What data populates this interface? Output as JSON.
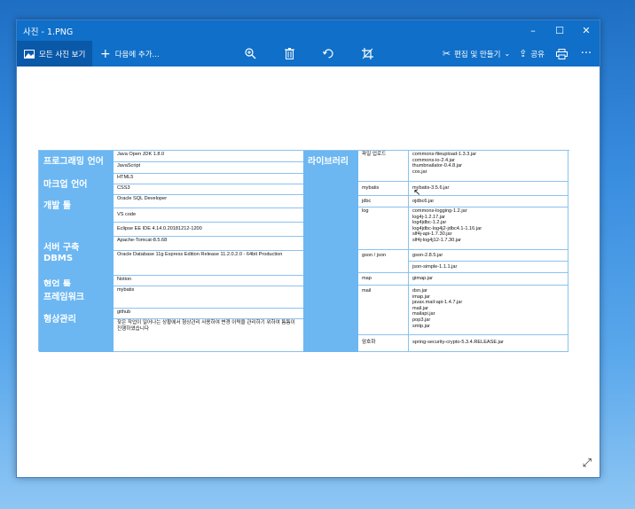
{
  "window": {
    "title": "사진 - 1.PNG",
    "controls": {
      "minimize": "–",
      "maximize": "☐",
      "close": "✕"
    }
  },
  "toolbar": {
    "all_photos": "모든 사진 보기",
    "add_to": "다음에 추가...",
    "edit_create": "편집 및 만들기",
    "share": "공유",
    "more": "···"
  },
  "icons": [
    "photo-icon",
    "plus-icon",
    "zoom-in-icon",
    "trash-icon",
    "rotate-icon",
    "crop-icon",
    "edit-icon",
    "share-icon",
    "print-icon",
    "more-icon",
    "expand-icon"
  ],
  "document": {
    "left": [
      {
        "category": "프로그래밍 언어",
        "values": [
          "Java Open JDK 1.8.0",
          "JavaScript"
        ]
      },
      {
        "category": "마크업 언어",
        "values": [
          "HTML5",
          "CSS3"
        ]
      },
      {
        "category": "개발 툴",
        "values": [
          "Oracle SQL Developer",
          "VS code",
          "Eclipse EE IDE 4.14.0.20181212-1200"
        ]
      },
      {
        "category": "서버 구축",
        "values": [
          "Apache-Tomcat-8.5.68"
        ]
      },
      {
        "category": "DBMS",
        "values": [
          "Oracle Database 11g Express Edition Release 11.2.0.2.0 - 64bit Production"
        ]
      },
      {
        "category": "협업 툴",
        "values": [
          "Notion"
        ]
      },
      {
        "category": "프레임워크",
        "values": [
          "mybatis"
        ]
      },
      {
        "category": "형상관리",
        "values": [
          "github",
          "잦은 작업이 일어나는 상황에서 형상관리 사용하여 변경 이력을 관리하기 위하여 틈틈이 진행하였습니다"
        ]
      }
    ],
    "library_header": "라이브러리",
    "libraries": [
      {
        "name": "파일 업로드",
        "jars": "commons-fileupload-1.3.3.jar\ncommons-io-2.4.jar\nthumbnailator-0.4.8.jar\ncos.jar"
      },
      {
        "name": "mybatis",
        "jars": "mybatis-3.5.6.jar"
      },
      {
        "name": "jdbc",
        "jars": "ojdbc6.jar"
      },
      {
        "name": "log",
        "jars": "commons-logging-1.2.jar\nlog4j-1.2.17.jar\nlog4jdbc-1.2.jar\nlog4jdbc-log4j2-jdbc4.1-1.16.jar\nslf4j-api-1.7.30.jar\nslf4j-log4j12-1.7.30.jar"
      },
      {
        "name": "gson / json",
        "jars": "gson-2.8.5.jar"
      },
      {
        "name": "",
        "jars": "json-simple-1.1.1.jar"
      },
      {
        "name": "map",
        "jars": "gimap.jar"
      },
      {
        "name": "mail",
        "jars": "dsn.jar\nimap.jar\njavax.mail-api-1.4.7.jar\nmail.jar\nmailapi.jar\npop3.jar\nsmtp.jar"
      },
      {
        "name": "암호화",
        "jars": "spring-security-crypto-5.3.4.RELEASE.jar"
      }
    ]
  }
}
